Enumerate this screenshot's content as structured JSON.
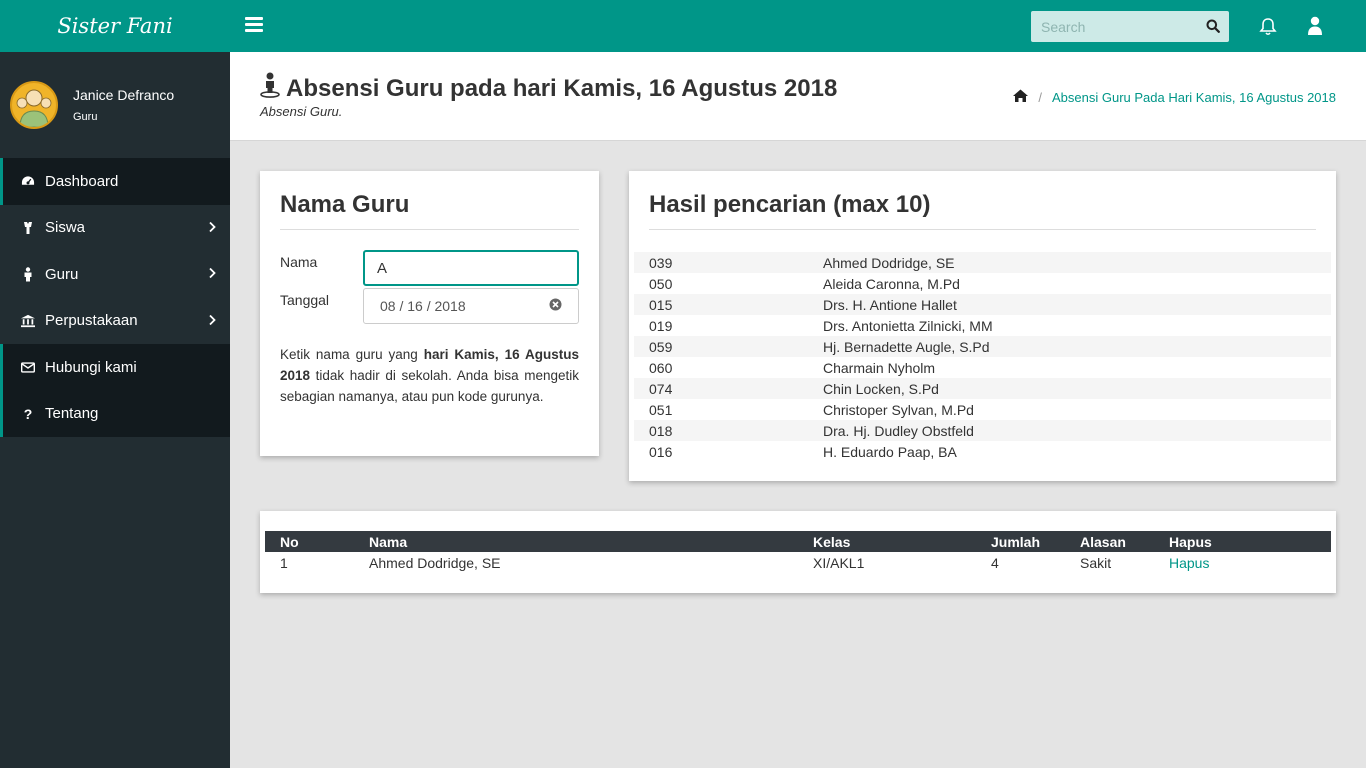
{
  "brand": "Sister Fani",
  "user": {
    "name": "Janice Defranco",
    "role": "Guru"
  },
  "menu": [
    {
      "label": "Dashboard",
      "icon": "dashboard-icon"
    },
    {
      "label": "Siswa",
      "icon": "student-icon"
    },
    {
      "label": "Guru",
      "icon": "teacher-icon"
    },
    {
      "label": "Perpustakaan",
      "icon": "library-icon"
    },
    {
      "label": "Hubungi kami",
      "icon": "envelope-icon"
    },
    {
      "label": "Tentang",
      "icon": "question-icon"
    }
  ],
  "topbar": {
    "search_placeholder": "Search"
  },
  "page": {
    "title": "Absensi Guru pada hari Kamis, 16 Agustus 2018",
    "subtitle": "Absensi Guru.",
    "breadcrumb": "Absensi Guru Pada Hari Kamis, 16 Agustus 2018"
  },
  "form": {
    "title": "Nama Guru",
    "nama_label": "Nama",
    "nama_value": "A",
    "tanggal_label": "Tanggal",
    "tanggal_value": "08 / 16 / 2018",
    "hint_pre": "Ketik nama guru yang ",
    "hint_bold": "hari Kamis, 16 Agustus 2018",
    "hint_post": " tidak hadir di sekolah. Anda bisa mengetik sebagian namanya, atau pun kode gurunya."
  },
  "results": {
    "title": "Hasil pencarian (max 10)",
    "items": [
      {
        "code": "039",
        "name": "Ahmed Dodridge, SE"
      },
      {
        "code": "050",
        "name": "Aleida Caronna, M.Pd"
      },
      {
        "code": "015",
        "name": "Drs. H. Antione Hallet"
      },
      {
        "code": "019",
        "name": "Drs. Antonietta Zilnicki, MM"
      },
      {
        "code": "059",
        "name": "Hj. Bernadette Augle, S.Pd"
      },
      {
        "code": "060",
        "name": "Charmain Nyholm"
      },
      {
        "code": "074",
        "name": "Chin Locken, S.Pd"
      },
      {
        "code": "051",
        "name": "Christoper Sylvan, M.Pd"
      },
      {
        "code": "018",
        "name": "Dra. Hj. Dudley Obstfeld"
      },
      {
        "code": "016",
        "name": "H. Eduardo Paap, BA"
      }
    ]
  },
  "table": {
    "headers": [
      "No",
      "Nama",
      "Kelas",
      "Jumlah",
      "Alasan",
      "Hapus"
    ],
    "rows": [
      {
        "no": "1",
        "nama": "Ahmed Dodridge, SE",
        "kelas": "XI/AKL1",
        "jumlah": "4",
        "alasan": "Sakit",
        "hapus": "Hapus"
      }
    ]
  },
  "colors": {
    "accent": "#009688",
    "sidebar": "#222d32",
    "sidebar_dark": "#121a1e",
    "table_header": "#343a40"
  }
}
